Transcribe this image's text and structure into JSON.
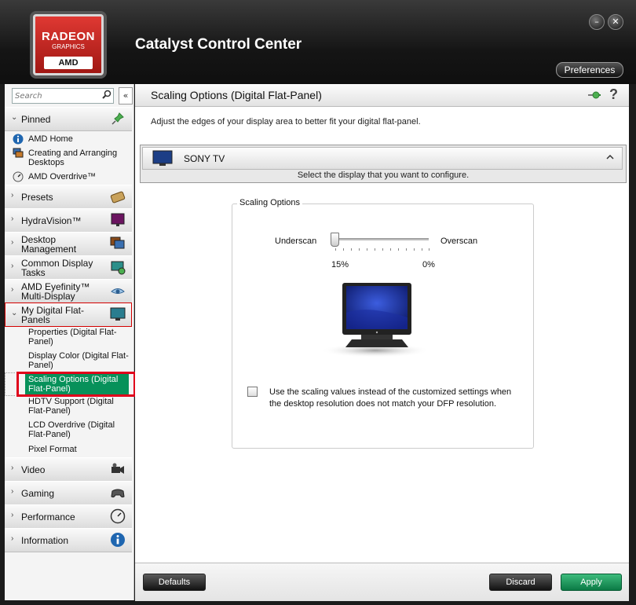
{
  "window": {
    "title": "Catalyst Control Center",
    "logo": {
      "line1": "RADEON",
      "line2": "GRAPHICS",
      "line3": "AMD"
    },
    "minimize_glyph": "–",
    "close_glyph": "✕",
    "preferences_label": "Preferences"
  },
  "sidebar": {
    "search_placeholder": "Search",
    "collapse_glyph": "«",
    "pinned": {
      "label": "Pinned",
      "items": [
        {
          "label": "AMD Home",
          "icon": "info-icon"
        },
        {
          "label": "Creating and Arranging Desktops",
          "icon": "desktops-icon"
        },
        {
          "label": "AMD Overdrive™",
          "icon": "gauge-icon"
        }
      ]
    },
    "categories": [
      {
        "label": "Presets",
        "icon": "presets-icon"
      },
      {
        "label": "HydraVision™",
        "icon": "hydravision-icon"
      },
      {
        "label": "Desktop Management",
        "icon": "desktop-management-icon"
      },
      {
        "label": "Common Display Tasks",
        "icon": "display-tasks-icon"
      },
      {
        "label": "AMD Eyefinity™ Multi-Display",
        "icon": "eyefinity-icon"
      },
      {
        "label": "My Digital Flat-Panels",
        "icon": "flat-panel-icon"
      },
      {
        "label": "Video",
        "icon": "video-camera-icon"
      },
      {
        "label": "Gaming",
        "icon": "gamepad-icon"
      },
      {
        "label": "Performance",
        "icon": "gauge-icon"
      },
      {
        "label": "Information",
        "icon": "info-icon"
      }
    ],
    "flat_panel_items": [
      {
        "label": "Properties (Digital Flat-Panel)"
      },
      {
        "label": "Display Color (Digital Flat-Panel)"
      },
      {
        "label": "Scaling Options (Digital Flat-Panel)"
      },
      {
        "label": "HDTV Support (Digital Flat-Panel)"
      },
      {
        "label": "LCD Overdrive (Digital Flat-Panel)"
      },
      {
        "label": "Pixel Format"
      }
    ],
    "active_item": "Scaling Options (Digital Flat-Panel)"
  },
  "main": {
    "title": "Scaling Options (Digital Flat-Panel)",
    "help_glyph": "?",
    "description": "Adjust the edges of your display area to better fit your digital flat-panel.",
    "display_selector": {
      "name": "SONY TV",
      "hint": "Select the display that you want to configure.",
      "chevron": "^"
    },
    "scaling_group": {
      "title": "Scaling Options",
      "underscan_label": "Underscan",
      "overscan_label": "Overscan",
      "left_value": "15%",
      "right_value": "0%",
      "slider_position": 0.0,
      "checkbox_checked": false,
      "checkbox_text": "Use the scaling values instead of the customized settings when the desktop resolution does not match your DFP resolution."
    }
  },
  "footer": {
    "defaults_label": "Defaults",
    "discard_label": "Discard",
    "apply_label": "Apply"
  },
  "colors": {
    "accent_green": "#07915a",
    "selection_red": "#e0001b"
  }
}
